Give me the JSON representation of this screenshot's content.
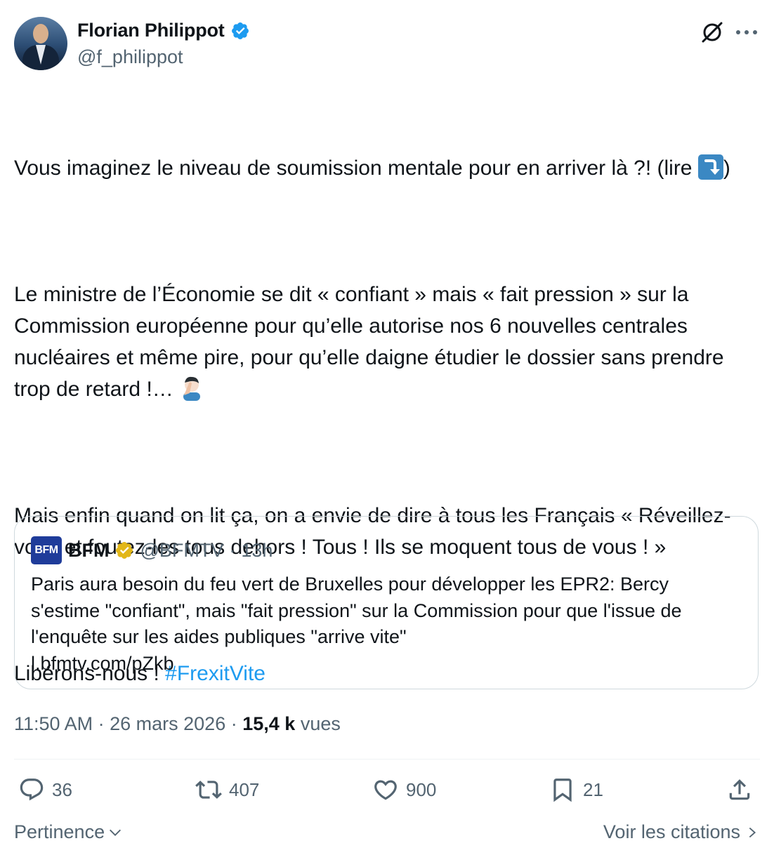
{
  "author": {
    "name": "Florian Philippot",
    "handle": "@f_philippot",
    "verified_color": "#1d9bf0"
  },
  "tweet": {
    "para1": "Vous imaginez le niveau de soumission mentale pour en arriver là ?! (lire ",
    "para1_end": ")",
    "para2": "Le ministre de l’Économie se dit « confiant » mais « fait pression » sur la Commission européenne pour qu’elle autorise nos 6 nouvelles centrales nucléaires et même pire, pour qu’elle daigne étudier le dossier sans prendre trop de retard !… ",
    "para3": "Mais enfin quand on lit ça, on a envie de dire à tous les Français « Réveillez-vous et foutez-les tous dehors ! Tous ! Ils se moquent tous de vous ! »",
    "para4": "Libérons-nous ! ",
    "hashtag": "#FrexitVite"
  },
  "quote": {
    "logo_text": "BFM",
    "name": "BFM",
    "handle": "@BFMTV",
    "separator": "·",
    "time": "13h",
    "text": "Paris aura besoin du feu vert de Bruxelles pour développer les EPR2: Bercy s'estime \"confiant\", mais \"fait pression\" sur la Commission pour que l'issue de l'enquête sur les aides publiques \"arrive vite\"",
    "link": "l.bfmtv.com/pZkb"
  },
  "meta": {
    "time": "11:50 AM",
    "separator": "·",
    "date": "26 mars 2026",
    "views_count": "15,4 k",
    "views_label": "vues"
  },
  "actions": {
    "replies": "36",
    "reposts": "407",
    "likes": "900",
    "bookmarks": "21"
  },
  "footer": {
    "sort_label": "Pertinence",
    "quotes_link": "Voir les citations"
  }
}
